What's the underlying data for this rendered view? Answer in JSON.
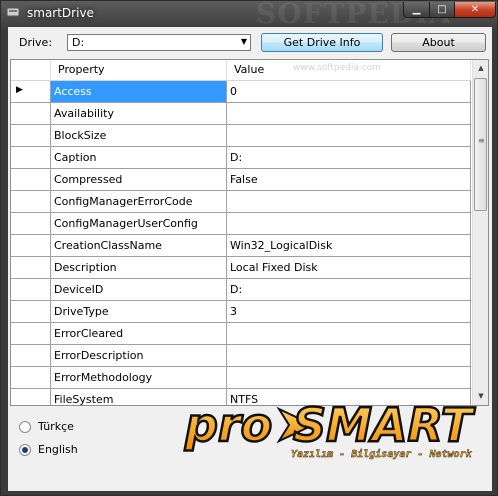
{
  "window": {
    "title": "smartDrive",
    "watermark": "SOFTPEDIA"
  },
  "toolbar": {
    "drive_label": "Drive:",
    "drive_value": "D:",
    "get_drive_info_label": "Get Drive Info",
    "about_label": "About"
  },
  "grid": {
    "columns": [
      "Property",
      "Value"
    ],
    "rows": [
      {
        "property": "Access",
        "value": "0"
      },
      {
        "property": "Availability",
        "value": ""
      },
      {
        "property": "BlockSize",
        "value": ""
      },
      {
        "property": "Caption",
        "value": "D:"
      },
      {
        "property": "Compressed",
        "value": "False"
      },
      {
        "property": "ConfigManagerErrorCode",
        "value": ""
      },
      {
        "property": "ConfigManagerUserConfig",
        "value": ""
      },
      {
        "property": "CreationClassName",
        "value": "Win32_LogicalDisk"
      },
      {
        "property": "Description",
        "value": "Local Fixed Disk"
      },
      {
        "property": "DeviceID",
        "value": "D:"
      },
      {
        "property": "DriveType",
        "value": "3"
      },
      {
        "property": "ErrorCleared",
        "value": ""
      },
      {
        "property": "ErrorDescription",
        "value": ""
      },
      {
        "property": "ErrorMethodology",
        "value": ""
      },
      {
        "property": "FileSystem",
        "value": "NTFS"
      }
    ],
    "selected_row": 0,
    "grid_watermark": "www.softpedia.com"
  },
  "language": {
    "options": [
      {
        "label": "Türkçe",
        "checked": false
      },
      {
        "label": "English",
        "checked": true
      }
    ]
  },
  "logo": {
    "brand_part1": "pro",
    "brand_part2": "SMART",
    "tagline": "Yazılım - Bilgisayar - Network"
  },
  "colors": {
    "selection": "#3399ff",
    "logo_orange": "#f5a623",
    "logo_dark": "#111111"
  }
}
